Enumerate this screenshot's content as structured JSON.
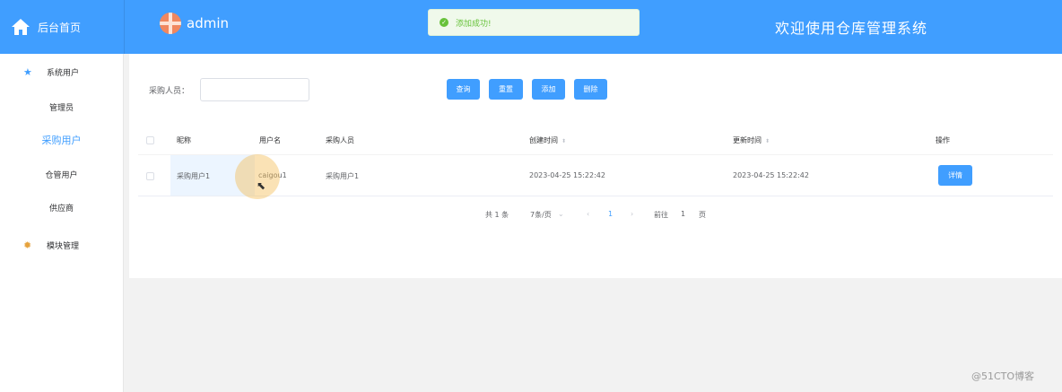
{
  "header": {
    "home_label": "后台首页",
    "user_name": "admin",
    "welcome": "欢迎使用仓库管理系统",
    "toast": "添加成功!"
  },
  "sidebar": {
    "groups": [
      {
        "label": "系统用户",
        "icon": "star-icon"
      },
      {
        "label": "模块管理",
        "icon": "gear-icon"
      }
    ],
    "items": [
      "管理员",
      "采购用户",
      "仓管用户",
      "供应商"
    ],
    "active_item": "采购用户"
  },
  "search": {
    "label": "采购人员：",
    "value": "",
    "placeholder": ""
  },
  "toolbar": {
    "query": "查询",
    "reset": "重置",
    "add": "添加",
    "delete": "删除"
  },
  "table": {
    "columns": [
      "昵称",
      "用户名",
      "采购人员",
      "创建时间",
      "更新时间",
      "操作"
    ],
    "rows": [
      {
        "nickname": "采购用户1",
        "username": "caigou1",
        "purchaser": "采购用户1",
        "created": "2023-04-25 15:22:42",
        "updated": "2023-04-25 15:22:42",
        "action": "详情"
      }
    ]
  },
  "pagination": {
    "total": "共 1 条",
    "page_size": "7条/页",
    "prev": "‹",
    "current": "1",
    "next": "›",
    "goto_label": "前往",
    "goto_value": "1",
    "page_suffix": "页"
  },
  "watermark": "@51CTO博客",
  "colors": {
    "primary": "#409eff",
    "success": "#67c23a"
  }
}
